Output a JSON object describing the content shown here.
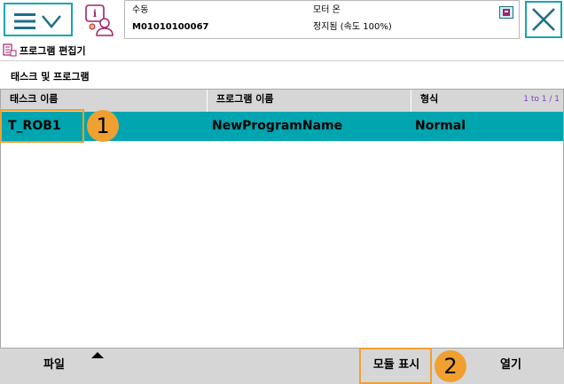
{
  "status": {
    "mode": "수동",
    "controller": "M01010100067",
    "motor": "모터 온",
    "state": "정지됨 (속도 100%)"
  },
  "app": {
    "title": "프로그램 편집기",
    "section_label": "태스크 및 프로그램"
  },
  "table": {
    "columns": [
      "태스크 이름",
      "프로그램 이름",
      "형식"
    ],
    "paging": "1 to 1 / 1",
    "rows": [
      {
        "task": "T_ROB1",
        "program": "NewProgramName",
        "type": "Normal"
      }
    ]
  },
  "annotations": {
    "badge1": "1",
    "badge2": "2"
  },
  "bottom": {
    "file": "파일",
    "show_modules": "모듈 표시",
    "open": "열기"
  },
  "colors": {
    "accent": "#16a5b2",
    "selected_row": "#00a5b0",
    "highlight": "#f0a030"
  }
}
